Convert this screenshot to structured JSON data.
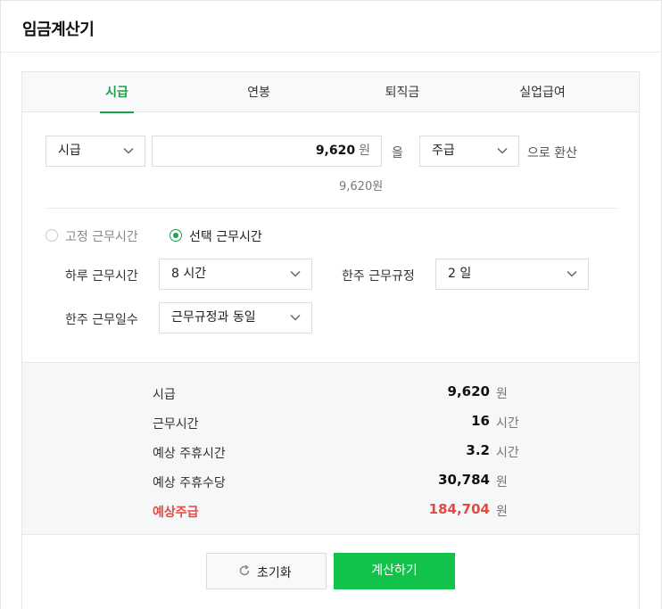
{
  "app": {
    "title": "임금계산기"
  },
  "tabs": [
    {
      "label": "시급",
      "active": true
    },
    {
      "label": "연봉",
      "active": false
    },
    {
      "label": "퇴직금",
      "active": false
    },
    {
      "label": "실업급여",
      "active": false
    }
  ],
  "converter": {
    "from_unit": "시급",
    "amount": "9,620",
    "amount_unit": "원",
    "particle": "을",
    "to_unit": "주급",
    "suffix": "으로 환산",
    "converted_display": "9,620원"
  },
  "work_mode": {
    "fixed_label": "고정 근무시간",
    "selected_label": "선택 근무시간",
    "selected": "selected"
  },
  "fields": {
    "daily_hours_label": "하루 근무시간",
    "daily_hours_value": "8 시간",
    "weekly_rule_label": "한주 근무규정",
    "weekly_rule_value": "2 일",
    "weekly_days_label": "한주 근무일수",
    "weekly_days_value": "근무규정과 동일"
  },
  "results": [
    {
      "label": "시급",
      "value": "9,620",
      "unit": "원",
      "highlight": false
    },
    {
      "label": "근무시간",
      "value": "16",
      "unit": "시간",
      "highlight": false
    },
    {
      "label": "예상 주휴시간",
      "value": "3.2",
      "unit": "시간",
      "highlight": false
    },
    {
      "label": "예상 주휴수당",
      "value": "30,784",
      "unit": "원",
      "highlight": false
    },
    {
      "label": "예상주급",
      "value": "184,704",
      "unit": "원",
      "highlight": true
    }
  ],
  "buttons": {
    "reset": "초기화",
    "calculate": "계산하기"
  },
  "colors": {
    "accent": "#1aa34a",
    "button_green": "#12c24b",
    "highlight_red": "#e5493f"
  },
  "icons": {
    "dropdown": "chevron-down-icon",
    "reset": "refresh-icon"
  }
}
